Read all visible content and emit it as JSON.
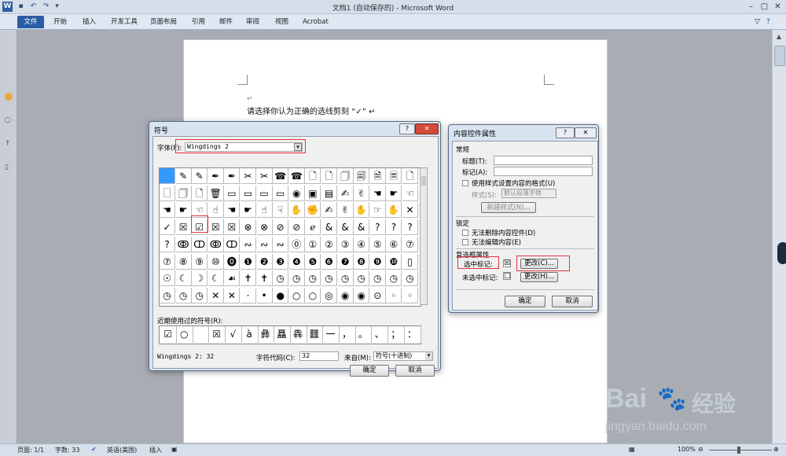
{
  "window": {
    "title": "文档1 (自动保存的) - Microsoft Word",
    "qa_icons": [
      "word-logo-icon",
      "save-icon",
      "undo-icon",
      "redo-icon",
      "customize-icon"
    ]
  },
  "ribbon": {
    "tabs": [
      "文件",
      "开始",
      "插入",
      "开发工具",
      "页面布局",
      "引用",
      "邮件",
      "审阅",
      "视图",
      "Acrobat"
    ]
  },
  "document": {
    "line1": "请选择你认为正确的选线剪刻 “✓” ↵",
    "para_mark": "↵"
  },
  "symbol_dialog": {
    "title": "符号",
    "font_label": "字体(F):",
    "font_value": "Wingdings 2",
    "recent_label": "近期使用过的符号(R):",
    "recent_symbols": [
      "☑",
      "○",
      "",
      "☒",
      "√",
      "à",
      "彝",
      "矗",
      "犇",
      "䨻",
      "一",
      "，",
      "。",
      "、",
      "；",
      "："
    ],
    "status_left": "Wingdings 2: 32",
    "charcode_label": "字符代码(C):",
    "charcode_value": "32",
    "from_label": "来自(M):",
    "from_value": "符号(十进制)",
    "ok": "确定",
    "cancel": "取消",
    "grid": [
      [
        "",
        "✎",
        "✎",
        "✒",
        "✒",
        "✂",
        "✂",
        "☎",
        "☎",
        "🗋",
        "🗋",
        "🗍",
        "🗐",
        "🗎",
        "🗏",
        "🗋"
      ],
      [
        "🗌",
        "🗍",
        "🗋",
        "🗑",
        "▭",
        "▭",
        "▭",
        "▭",
        "◉",
        "▣",
        "▤",
        "✍",
        "✌",
        "☚",
        "☛",
        "☜"
      ],
      [
        "☚",
        "☛",
        "☜",
        "☝",
        "☚",
        "☛",
        "☝",
        "☟",
        "✋",
        "✊",
        "✍",
        "✌",
        "✋",
        "☞",
        "✋",
        "✕"
      ],
      [
        "✓",
        "☒",
        "☑",
        "☒",
        "☒",
        "⊗",
        "⊗",
        "⊘",
        "⊘",
        "ℯ",
        "&",
        "&",
        "&",
        "?",
        "?",
        "?"
      ],
      [
        "?",
        "ↂ",
        "ↀ",
        "ↂ",
        "ↀ",
        "∾",
        "∾",
        "∾",
        "⓪",
        "①",
        "②",
        "③",
        "④",
        "⑤",
        "⑥",
        "⑦"
      ],
      [
        "⑦",
        "⑧",
        "⑨",
        "⑩",
        "⓿",
        "❶",
        "❷",
        "❸",
        "❹",
        "❺",
        "❻",
        "❼",
        "❽",
        "❾",
        "❿",
        "▯"
      ],
      [
        "☉",
        "☾",
        "☽",
        "☾",
        "☙",
        "✝",
        "✝",
        "◷",
        "◷",
        "◷",
        "◷",
        "◷",
        "◷",
        "◷",
        "◷",
        "◷"
      ],
      [
        "◷",
        "◷",
        "◷",
        "✕",
        "✕",
        "·",
        "•",
        "●",
        "○",
        "○",
        "◎",
        "◉",
        "◉",
        "⊙",
        "◦",
        "◦"
      ]
    ]
  },
  "cc_dialog": {
    "title": "内容控件属性",
    "general": "常规",
    "title_label": "标题(T):",
    "tag_label": "标记(A):",
    "use_style": "使用样式设置内容的格式(U)",
    "style_label": "样式(S):",
    "style_value": "默认段落字体",
    "new_style": "新建样式(N)...",
    "locking": "锁定",
    "lock_delete": "无法删除内容控件(D)",
    "lock_edit": "无法编辑内容(E)",
    "checkbox_props": "复选框属性",
    "checked_label": "选中标记:",
    "checked_symbol": "☒",
    "unchecked_label": "未选中标记:",
    "unchecked_symbol": "□",
    "change1": "更改(C)...",
    "change2": "更改(H)...",
    "ok": "确定",
    "cancel": "取消"
  },
  "status": {
    "page": "页面: 1/1",
    "words": "字数: 33",
    "lang": "英语(美国)",
    "mode": "插入",
    "zoom": "100%"
  },
  "watermark": {
    "brand": "Bai",
    "brand2": "经验",
    "url": "jingyan.baidu.com"
  }
}
